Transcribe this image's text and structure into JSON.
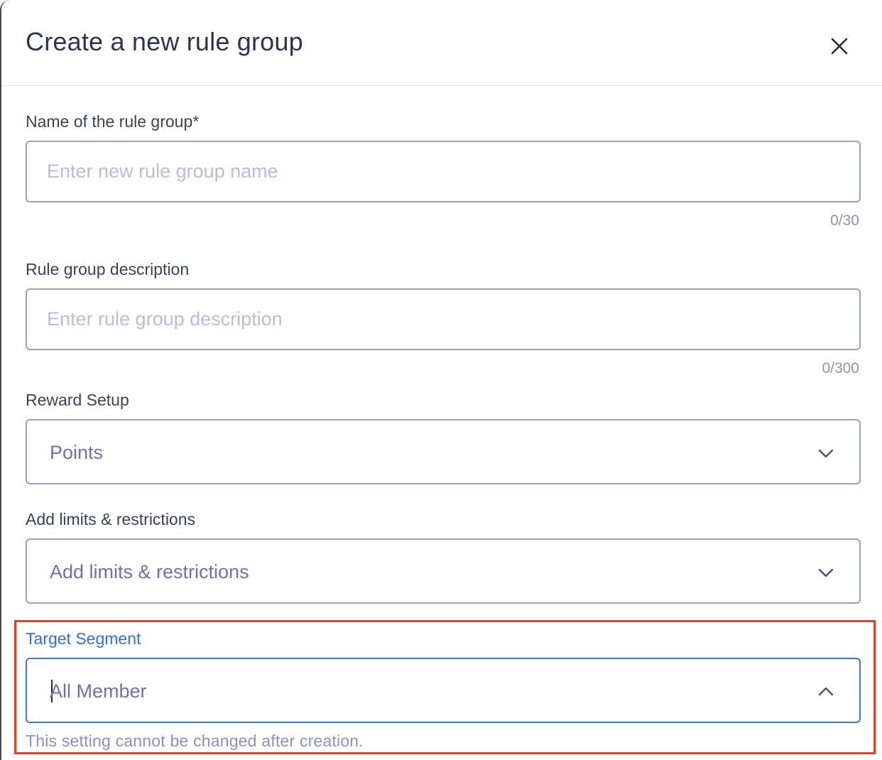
{
  "dialog": {
    "title": "Create a new rule group",
    "close_icon": "close-icon"
  },
  "name_field": {
    "label": "Name of the rule group*",
    "placeholder": "Enter new rule group name",
    "value": "",
    "counter": "0/30"
  },
  "description_field": {
    "label": "Rule group description",
    "placeholder": "Enter rule group description",
    "value": "",
    "counter": "0/300"
  },
  "reward_setup": {
    "label": "Reward Setup",
    "selected": "Points",
    "icon": "chevron-down-icon"
  },
  "limits": {
    "label": "Add limits & restrictions",
    "selected": "Add limits & restrictions",
    "icon": "chevron-down-icon"
  },
  "target_segment": {
    "label": "Target Segment",
    "selected": "All Member",
    "icon": "chevron-up-icon",
    "hint": "This setting cannot be changed after creation."
  },
  "colors": {
    "title": "#2b3553",
    "field_border": "#9a9dcf",
    "focus_border": "#3a79ea",
    "focus_label": "#2f6fe6",
    "highlight": "#e04128",
    "muted_text": "#8b90c4"
  }
}
